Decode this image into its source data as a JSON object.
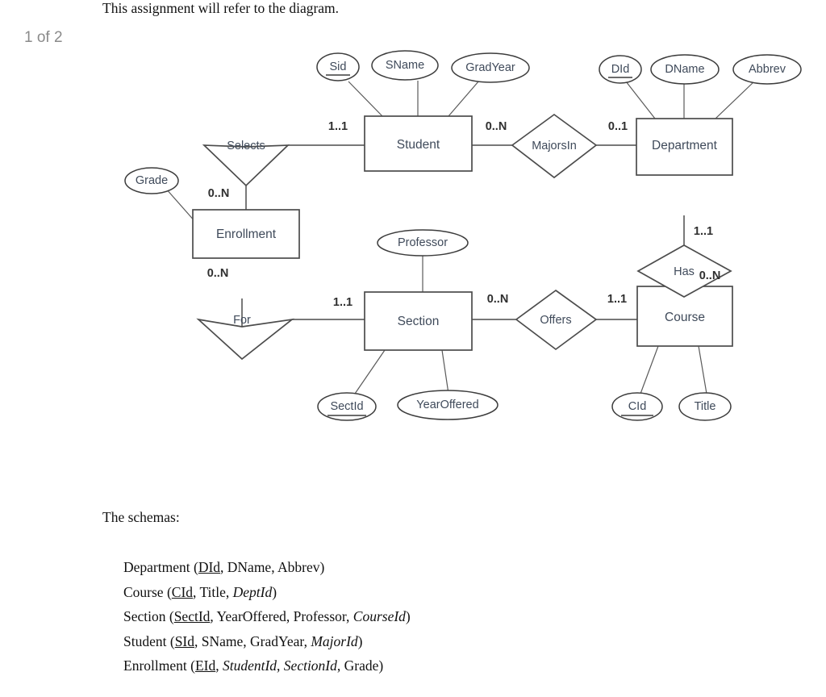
{
  "intro": {
    "text": "This assignment will refer to the diagram."
  },
  "page_indicator": {
    "text": "1 of 2"
  },
  "diagram": {
    "entities": [
      {
        "id": "student",
        "label": "Student"
      },
      {
        "id": "department",
        "label": "Department"
      },
      {
        "id": "enrollment",
        "label": "Enrollment"
      },
      {
        "id": "section",
        "label": "Section"
      },
      {
        "id": "course",
        "label": "Course"
      }
    ],
    "relationships": [
      {
        "id": "selects",
        "label": "Selects"
      },
      {
        "id": "majorsin",
        "label": "MajorsIn"
      },
      {
        "id": "has",
        "label": "Has"
      },
      {
        "id": "for",
        "label": "For"
      },
      {
        "id": "offers",
        "label": "Offers"
      }
    ],
    "attributes": [
      {
        "id": "sid",
        "label": "Sid",
        "key": true,
        "owner": "student"
      },
      {
        "id": "sname",
        "label": "SName",
        "key": false,
        "owner": "student"
      },
      {
        "id": "gradyear",
        "label": "GradYear",
        "key": false,
        "owner": "student"
      },
      {
        "id": "did",
        "label": "DId",
        "key": true,
        "owner": "department"
      },
      {
        "id": "dname",
        "label": "DName",
        "key": false,
        "owner": "department"
      },
      {
        "id": "abbrev",
        "label": "Abbrev",
        "key": false,
        "owner": "department"
      },
      {
        "id": "grade",
        "label": "Grade",
        "key": false,
        "owner": "enrollment"
      },
      {
        "id": "professor",
        "label": "Professor",
        "key": false,
        "owner": "section"
      },
      {
        "id": "sectid",
        "label": "SectId",
        "key": true,
        "owner": "section"
      },
      {
        "id": "yearoffered",
        "label": "YearOffered",
        "key": false,
        "owner": "section"
      },
      {
        "id": "cid",
        "label": "CId",
        "key": true,
        "owner": "course"
      },
      {
        "id": "title",
        "label": "Title",
        "key": false,
        "owner": "course"
      }
    ],
    "cardinalities": [
      {
        "id": "selects-student",
        "text": "1..1"
      },
      {
        "id": "student-majorsin",
        "text": "0..N"
      },
      {
        "id": "majorsin-department",
        "text": "0..1"
      },
      {
        "id": "selects-enrollment",
        "text": "0..N"
      },
      {
        "id": "department-has",
        "text": "1..1"
      },
      {
        "id": "has-course",
        "text": "0..N"
      },
      {
        "id": "enrollment-for",
        "text": "0..N"
      },
      {
        "id": "for-section",
        "text": "1..1"
      },
      {
        "id": "section-offers",
        "text": "0..N"
      },
      {
        "id": "offers-course",
        "text": "1..1"
      }
    ]
  },
  "schemas": {
    "heading": "The schemas:",
    "lines": [
      {
        "id": "department",
        "name": "Department",
        "parts": [
          {
            "text": "DId",
            "style": "pk"
          },
          {
            "text": "DName",
            "style": "plain"
          },
          {
            "text": "Abbrev",
            "style": "plain"
          }
        ]
      },
      {
        "id": "course",
        "name": "Course",
        "parts": [
          {
            "text": "CId",
            "style": "pk"
          },
          {
            "text": "Title",
            "style": "plain"
          },
          {
            "text": "DeptId",
            "style": "fk"
          }
        ]
      },
      {
        "id": "section",
        "name": "Section",
        "parts": [
          {
            "text": "SectId",
            "style": "pk"
          },
          {
            "text": "YearOffered",
            "style": "plain"
          },
          {
            "text": "Professor",
            "style": "plain"
          },
          {
            "text": "CourseId",
            "style": "fk"
          }
        ]
      },
      {
        "id": "student",
        "name": "Student",
        "parts": [
          {
            "text": "SId",
            "style": "pk"
          },
          {
            "text": "SName",
            "style": "plain"
          },
          {
            "text": "GradYear",
            "style": "plain"
          },
          {
            "text": "MajorId",
            "style": "fk"
          }
        ]
      },
      {
        "id": "enrollment",
        "name": "Enrollment",
        "parts": [
          {
            "text": "EId",
            "style": "pk"
          },
          {
            "text": "StudentId",
            "style": "fk"
          },
          {
            "text": "SectionId",
            "style": "fk"
          },
          {
            "text": "Grade",
            "style": "plain"
          }
        ]
      }
    ]
  },
  "colors": {
    "stroke": "#4c4c4c",
    "text": "#3f4a5a",
    "page_indicator": "#8a8a8a"
  }
}
